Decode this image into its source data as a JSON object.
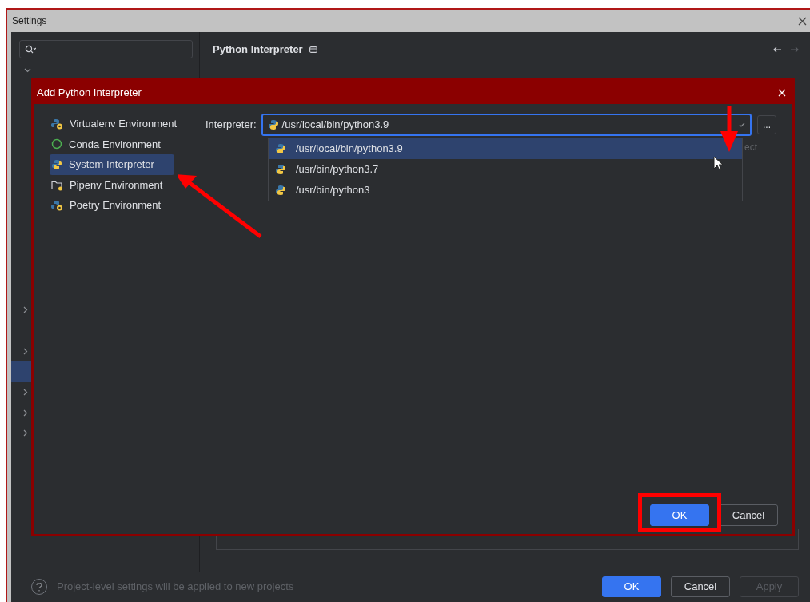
{
  "settings": {
    "title": "Settings",
    "sidebar": {
      "top_item": {
        "expanded": true
      },
      "rows": [
        {
          "expandable": true,
          "selected": false
        },
        {
          "expandable": true,
          "selected": false
        },
        {
          "expandable": false,
          "selected": true
        },
        {
          "expandable": true,
          "selected": false
        },
        {
          "expandable": true,
          "selected": false
        },
        {
          "expandable": true,
          "selected": false
        }
      ]
    },
    "page_title": "Python Interpreter",
    "footer": {
      "hint": "Project-level settings will be applied to new projects",
      "buttons": [
        {
          "label": "OK",
          "kind": "primary"
        },
        {
          "label": "Cancel",
          "kind": "secondary"
        },
        {
          "label": "Apply",
          "kind": "disabled"
        }
      ]
    }
  },
  "dialog": {
    "title": "Add Python Interpreter",
    "environments": [
      {
        "label": "Virtualenv Environment",
        "kind": "python-gear",
        "selected": false
      },
      {
        "label": "Conda Environment",
        "kind": "ring",
        "selected": false
      },
      {
        "label": "System Interpreter",
        "kind": "python",
        "selected": true
      },
      {
        "label": "Pipenv Environment",
        "kind": "folder",
        "selected": false
      },
      {
        "label": "Poetry Environment",
        "kind": "python-gear",
        "selected": false
      }
    ],
    "interpreter_label": "Interpreter:",
    "interpreter_value": "/usr/local/bin/python3.9",
    "browse_button": "...",
    "partial_text": "ect",
    "options": [
      {
        "label": "/usr/local/bin/python3.9",
        "selected": true
      },
      {
        "label": "/usr/bin/python3.7",
        "selected": false
      },
      {
        "label": "/usr/bin/python3",
        "selected": false
      }
    ],
    "buttons": [
      {
        "label": "OK",
        "kind": "primary"
      },
      {
        "label": "Cancel",
        "kind": "secondary"
      }
    ]
  }
}
